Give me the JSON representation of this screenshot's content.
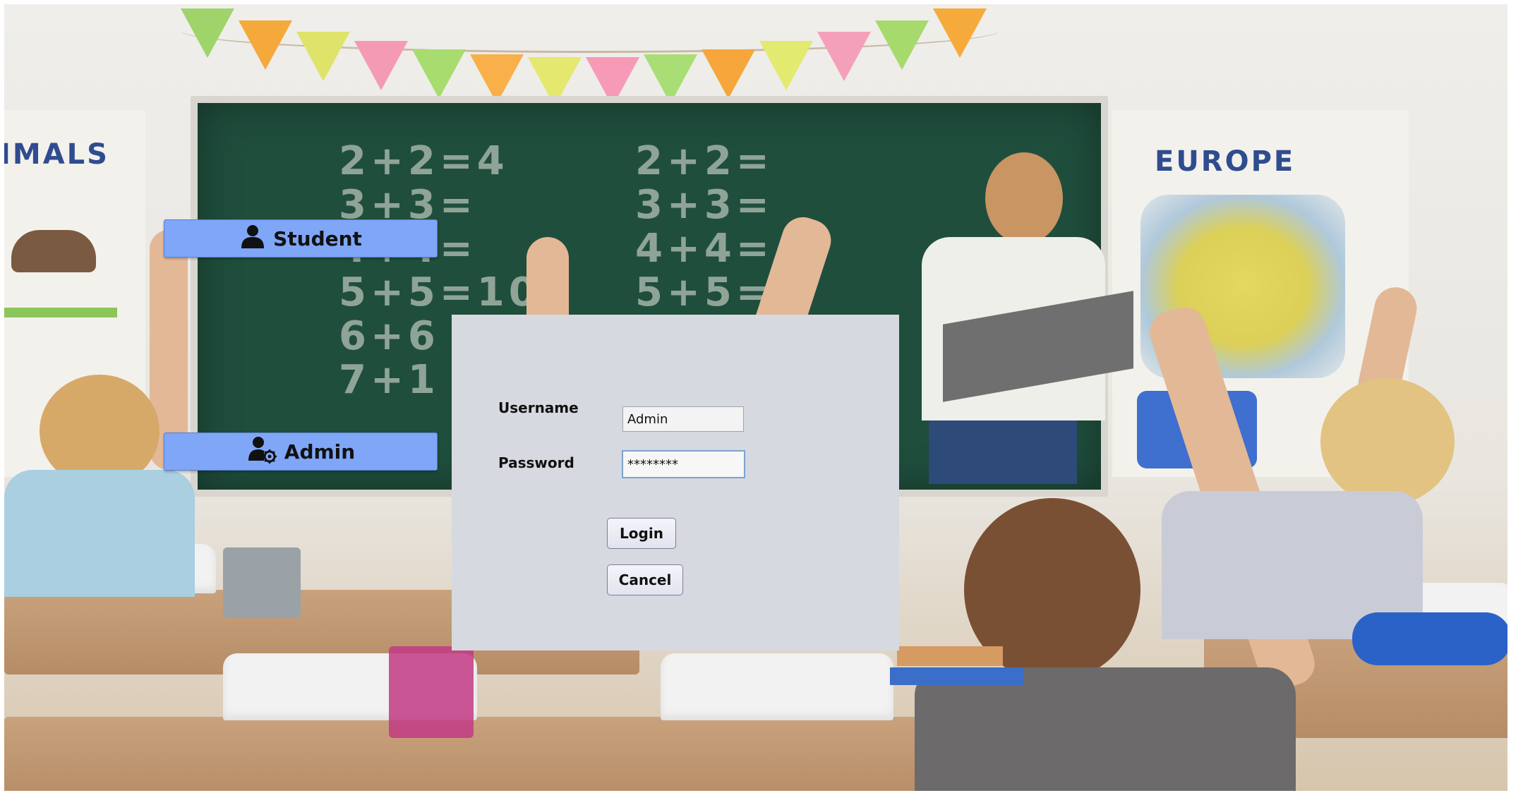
{
  "background": {
    "poster_left_word": "IMALS",
    "poster_right_word": "EUROPE",
    "chalk_left": [
      "2+2=4",
      "3+3=",
      "4+4=",
      "5+5=10",
      "6+6",
      "7+1"
    ],
    "chalk_right": [
      "2+2=",
      "3+3=",
      "4+4=",
      "5+5="
    ],
    "pennant_colors": [
      "#9fd46b",
      "#f6a93b",
      "#dfe36a",
      "#f59ab3",
      "#a8dc6f",
      "#f9b04a",
      "#e4e86e",
      "#f79ab8",
      "#a9de74",
      "#f6a63a",
      "#e2ea70",
      "#f5a0ba",
      "#a6da6c",
      "#f7aa3c"
    ]
  },
  "sidebar": {
    "student_button": {
      "label": "Student",
      "icon": "user-icon"
    },
    "admin_button": {
      "label": "Admin",
      "icon": "user-gear-icon"
    }
  },
  "login": {
    "username_label": "Username",
    "username_value": "Admin",
    "password_label": "Password",
    "password_value": "********",
    "login_button": "Login",
    "cancel_button": "Cancel"
  },
  "colors": {
    "accent_button": "#7fa6f7",
    "panel": "#d6d9e0"
  }
}
